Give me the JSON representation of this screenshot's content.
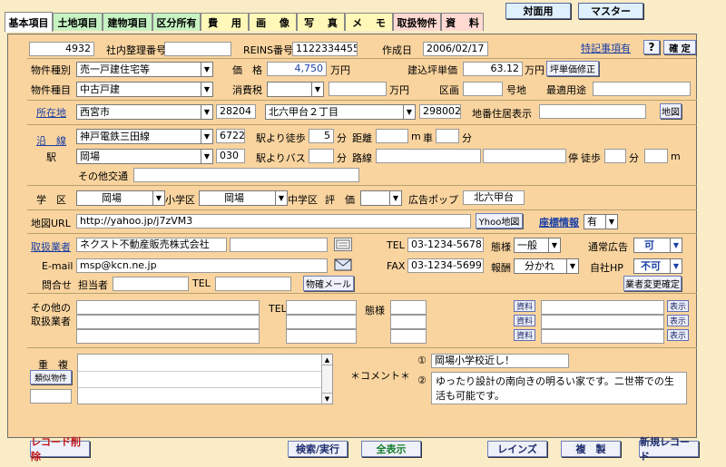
{
  "top_buttons": {
    "taimen": "対面用",
    "master": "マスター"
  },
  "tabs": [
    {
      "label": "基本項目",
      "color": "#ffffff"
    },
    {
      "label": "土地項目",
      "color": "#c7f2c2"
    },
    {
      "label": "建物項目",
      "color": "#c7f2c2"
    },
    {
      "label": "区分所有",
      "color": "#c7f2c2"
    },
    {
      "label": "費　 用",
      "color": "#fff8b8"
    },
    {
      "label": "画　 像",
      "color": "#fff8b8"
    },
    {
      "label": "写　 真",
      "color": "#fff8b8"
    },
    {
      "label": "メ　 モ",
      "color": "#fff8b8"
    },
    {
      "label": "取扱物件",
      "color": "#ffd9d2"
    },
    {
      "label": "資　 料",
      "color": "#ffd9d2"
    }
  ],
  "header": {
    "id": "4932",
    "internal_no_label": "社内整理番号",
    "internal_no": "",
    "reins_label": "REINS番号",
    "reins_no": "1122334455",
    "created_label": "作成日",
    "created": "2006/02/17",
    "tokki_label": "特記事項有",
    "help": "?",
    "confirm": "確 定"
  },
  "property": {
    "kind_label": "物件種別",
    "kind": "売一戸建住宅等",
    "price_label": "価　格",
    "price": "4,750",
    "price_unit": "万円",
    "tsubo_label": "建込坪単価",
    "tsubo": "63.12",
    "tsubo_unit": "万円",
    "tsubo_btn": "坪単価修正",
    "item_label": "物件種目",
    "item": "中古戸建",
    "tax_label": "消費税",
    "tax_select": "",
    "tax_value": "",
    "tax_unit": "万円",
    "kukaku_label": "区画",
    "kukaku": "",
    "gochi": "号地",
    "use_label": "最適用途",
    "use": ""
  },
  "location": {
    "label": "所在地",
    "city": "西宮市",
    "city_code": "28204",
    "area": "北六甲台２丁目",
    "area_code": "298002",
    "chiban_label": "地番住居表示",
    "chiban": "",
    "map_btn": "地図"
  },
  "line": {
    "label": "沿　線",
    "station_label": "駅",
    "line1": "神戸電鉄三田線",
    "line1_code": "6722",
    "walk_label": "駅より徒歩",
    "walk": "5",
    "walk_unit": "分",
    "dist_label": "距離",
    "dist": "",
    "m": "m",
    "car": "車",
    "car_val": "",
    "car_unit": "分",
    "station1": "岡場",
    "station1_code": "030",
    "bus_label": "駅よりバス",
    "bus": "",
    "bus_unit": "分",
    "route_label": "路線",
    "route": "",
    "stop": "停",
    "stop_walk_label": "徒歩",
    "stop_walk": "",
    "stop_walk_unit": "分",
    "stop_m": "",
    "m2": "m",
    "other_label": "その他交通",
    "other": ""
  },
  "school": {
    "label": "学　区",
    "elem": "岡場",
    "elem_label": "小学区",
    "junior": "岡場",
    "junior_label": "中学区",
    "rating_label": "評　価",
    "rating": "",
    "popup_label": "広告ポップ",
    "popup": "北六甲台"
  },
  "mapurl": {
    "label": "地図URL",
    "url": "http://yahoo.jp/j7zVM3",
    "yahoo_btn": "Yhoo地図",
    "coord_label": "座標情報",
    "coord": "有"
  },
  "agent": {
    "label": "取扱業者",
    "name": "ネクスト不動産販売株式会社",
    "name2": "",
    "tel_label": "TEL",
    "tel": "03-1234-5678",
    "style_label": "態様",
    "style": "一般",
    "ad_label": "通常広告",
    "ad": "可",
    "email_label": "E-mail",
    "email": "msp@kcn.ne.jp",
    "fax_label": "FAX",
    "fax": "03-1234-5699",
    "fee_label": "報酬",
    "fee": "分かれ",
    "hp_label": "自社HP",
    "hp": "不可",
    "contact_label": "問合せ",
    "person_label": "担当者",
    "person": "",
    "tel2_label": "TEL",
    "tel2": "",
    "mail_btn": "物確メール",
    "change_btn": "業者変更確定"
  },
  "others": {
    "label1": "その他の",
    "label2": "取扱業者",
    "tel_label": "TEL",
    "style_label": "態様",
    "shiryo": "資料",
    "hyoji": "表示"
  },
  "dup": {
    "label": "重　複",
    "similar": "類似物件",
    "comment_label": "＊コメント＊",
    "c1_no": "①",
    "c1": "岡場小学校近し！",
    "c2_no": "②",
    "c2": "ゆったり設計の南向きの明るい家です。二世帯での生活も可能です。"
  },
  "bottom": {
    "delete": "レコード削除",
    "search": "検索/実行",
    "showall": "全表示",
    "reins": "レインズ",
    "copy": "複　製",
    "newrec": "新規レコード"
  }
}
